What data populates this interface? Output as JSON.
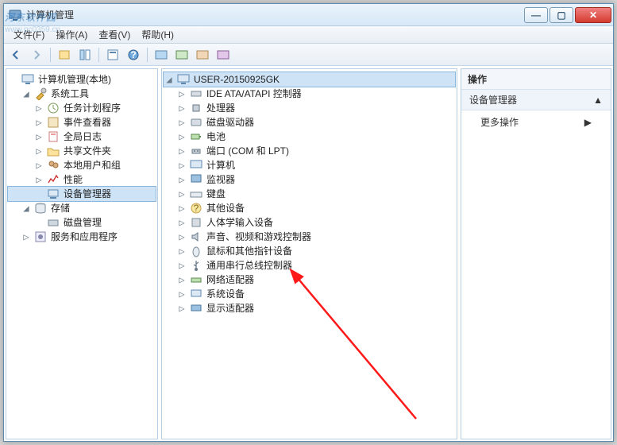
{
  "watermark": {
    "line1": "河东软件园",
    "line2": "www.pc0359.cn"
  },
  "window": {
    "title": "计算机管理",
    "buttons": {
      "min": "—",
      "max": "▢",
      "close": "✕"
    }
  },
  "menu": {
    "file": "文件(F)",
    "action": "操作(A)",
    "view": "查看(V)",
    "help": "帮助(H)"
  },
  "toolbar_icons": [
    "back",
    "forward",
    "up",
    "show-hide",
    "properties",
    "refresh",
    "help",
    "view1",
    "view2",
    "view3",
    "view4"
  ],
  "left_tree": {
    "root": "计算机管理(本地)",
    "system_tools": {
      "label": "系统工具",
      "items": [
        "任务计划程序",
        "事件查看器",
        "全局日志",
        "共享文件夹",
        "本地用户和组",
        "性能",
        "设备管理器"
      ]
    },
    "storage": {
      "label": "存储",
      "items": [
        "磁盘管理"
      ]
    },
    "services": {
      "label": "服务和应用程序"
    }
  },
  "mid_tree": {
    "root": "USER-20150925GK",
    "items": [
      "IDE ATA/ATAPI 控制器",
      "处理器",
      "磁盘驱动器",
      "电池",
      "端口 (COM 和 LPT)",
      "计算机",
      "监视器",
      "键盘",
      "其他设备",
      "人体学输入设备",
      "声音、视频和游戏控制器",
      "鼠标和其他指针设备",
      "通用串行总线控制器",
      "网络适配器",
      "系统设备",
      "显示适配器"
    ]
  },
  "right": {
    "header": "操作",
    "section": "设备管理器",
    "section_arrow": "▲",
    "item": "更多操作",
    "item_arrow": "▶"
  }
}
